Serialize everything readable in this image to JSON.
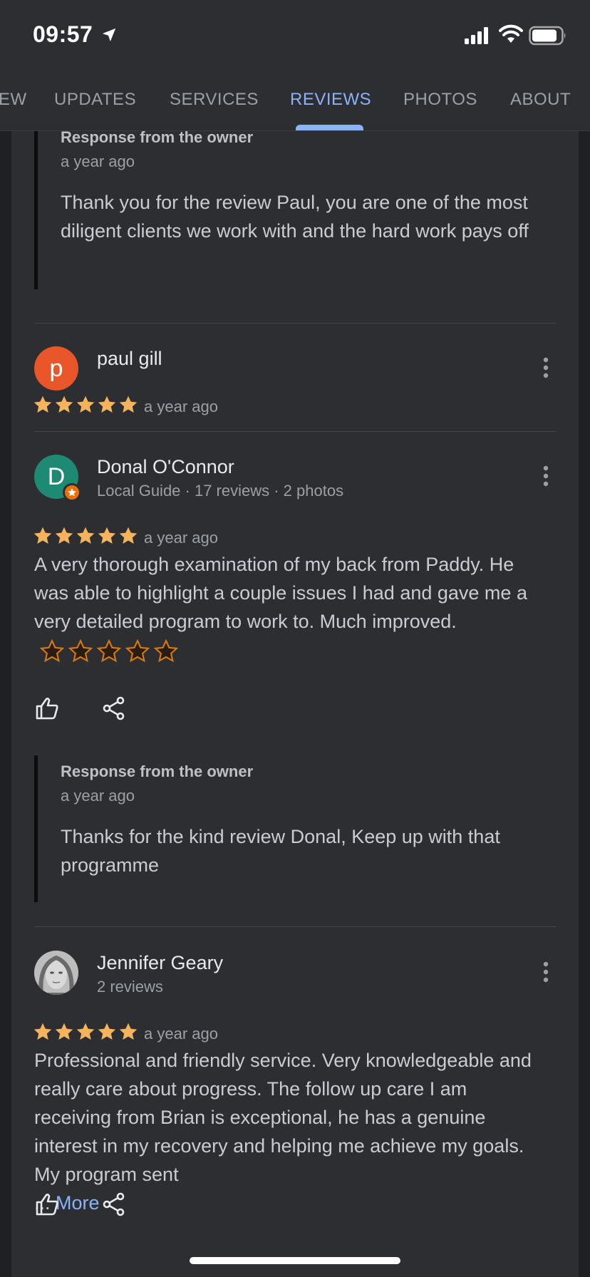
{
  "status_bar": {
    "time": "09:57"
  },
  "tabs": [
    {
      "label": "EW"
    },
    {
      "label": "UPDATES"
    },
    {
      "label": "SERVICES"
    },
    {
      "label": "REVIEWS",
      "active": true
    },
    {
      "label": "PHOTOS"
    },
    {
      "label": "ABOUT"
    }
  ],
  "owner_responses": [
    {
      "title": "Response from the owner",
      "time": "a year ago",
      "text": "Thank you for the review Paul, you are one of the most diligent clients we work with and the hard work pays off"
    },
    {
      "title": "Response from the owner",
      "time": "a year ago",
      "text": "Thanks for the kind review Donal, Keep up with that programme"
    }
  ],
  "reviews": [
    {
      "avatar_letter": "p",
      "avatar_color": "#e8562a",
      "name": "paul gill",
      "subtitle": "",
      "rating": 5,
      "time": "a year ago",
      "text": ""
    },
    {
      "avatar_letter": "D",
      "avatar_color": "#1e8a74",
      "name": "Donal O'Connor",
      "subtitle": "Local Guide · 17 reviews · 2 photos",
      "rating": 5,
      "time": "a year ago",
      "text": "A very thorough examination of my back from Paddy. He was able to highlight a couple issues I had and gave me a very detailed program to work to. Much improved."
    },
    {
      "avatar_letter": "",
      "avatar_color": "#8a8a8a",
      "name": "Jennifer Geary",
      "subtitle": "2 reviews",
      "rating": 5,
      "time": "a year ago",
      "text": "Professional and friendly service.  Very knowledgeable and really care about progress.  The follow up care I am receiving from Brian is exceptional, he has a genuine interest in my recovery and helping me achieve my goals.  My program sent",
      "ellipsis": "... ",
      "more_label": "More"
    }
  ],
  "colors": {
    "accent": "#8ab4f8",
    "star": "#f5b45c",
    "background": "#2d2e31"
  }
}
